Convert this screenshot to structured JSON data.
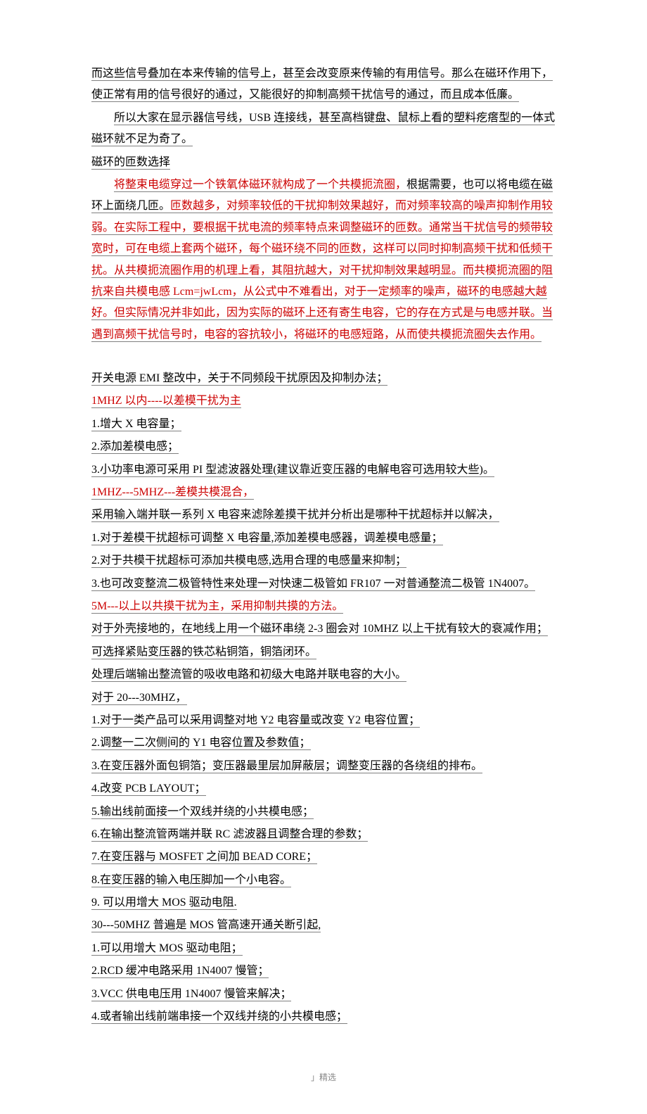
{
  "intro": {
    "p1": "而这些信号叠加在本来传输的信号上，甚至会改变原来传输的有用信号。那么在磁环作用下，使正常有用的信号很好的通过，又能很好的抑制高频干扰信号的通过，而且成本低廉。",
    "p2": "所以大家在显示器信号线，USB 连接线，甚至高档键盘、鼠标上看的塑料疙瘩型的一体式磁环就不足为奇了。",
    "p3": "磁环的匝数选择",
    "p4a": "将整束电缆穿过一个铁氧体磁环就构成了一个共模扼流圈，",
    "p4b": "根据需要，也可以将电缆在磁环上面绕几匝。",
    "p4c": "匝数越多，对频率较低的干扰抑制效果越好，而对频率较高的噪声抑制作用较弱。在实际工程中，要根据干扰电流的频率特点来调整磁环的匝数。通常当干扰信号的频带较宽时，可在电缆上套两个磁环，每个磁环绕不同的匝数，这样可以同时抑制高频干扰和低频干扰。从共模扼流圈作用的机理上看，其阻抗越大，对干扰抑制效果越明显。而共模扼流圈的阻抗来自共模电感 Lcm=jwLcm，从公式中不难看出，对于一定频率的噪声，磁环的电感越大越好。但实际情况并非如此，因为实际的磁环上还有寄生电容，它的存在方式是与电感并联。当遇到高频干扰信号时，电容的容抗较小，将磁环的电感短路，从而使共模扼流圈失去作用。"
  },
  "section": {
    "title": "开关电源 EMI 整改中，关于不同频段干扰原因及抑制办法；",
    "h1": "1MHZ 以内----以差模干扰为主",
    "s1_1": "1.增大 X 电容量；",
    "s1_2": "2.添加差模电感；",
    "s1_3": "3.小功率电源可采用 PI 型滤波器处理(建议靠近变压器的电解电容可选用较大些)。",
    "h2": "1MHZ---5MHZ---差模共模混合，",
    "s2_0": "采用输入端并联一系列 X 电容来滤除差摸干扰并分析出是哪种干扰超标并以解决，",
    "s2_1": "1.对于差模干扰超标可调整 X 电容量,添加差模电感器，调差模电感量；",
    "s2_2": "2.对于共模干扰超标可添加共模电感,选用合理的电感量来抑制；",
    "s2_3": "3.也可改变整流二极管特性来处理一对快速二极管如 FR107 一对普通整流二极管 1N4007。",
    "h3": "5M---以上以共摸干扰为主，采用抑制共摸的方法。",
    "s3_1": "对于外壳接地的，在地线上用一个磁环串绕 2-3 圈会对 10MHZ 以上干扰有较大的衰减作用；",
    "s3_2": "可选择紧贴变压器的铁芯粘铜箔，铜箔闭环。",
    "s3_3": "处理后端输出整流管的吸收电路和初级大电路并联电容的大小。",
    "h4": "对于 20---30MHZ，",
    "s4_1": "1.对于一类产品可以采用调整对地 Y2 电容量或改变 Y2 电容位置；",
    "s4_2": "2.调整一二次侧间的 Y1 电容位置及参数值；",
    "s4_3": "3.在变压器外面包铜箔；变压器最里层加屏蔽层；调整变压器的各绕组的排布。",
    "s4_4": "4.改变 PCB LAYOUT；",
    "s4_5": "5.输出线前面接一个双线并绕的小共模电感；",
    "s4_6": "6.在输出整流管两端并联 RC 滤波器且调整合理的参数；",
    "s4_7": "7.在变压器与 MOSFET 之间加 BEAD CORE；",
    "s4_8": "8.在变压器的输入电压脚加一个小电容。",
    "s4_9": "9. 可以用增大 MOS 驱动电阻.",
    "h5": "30---50MHZ 普遍是 MOS 管高速开通关断引起,",
    "s5_1": "1.可以用增大 MOS 驱动电阻；",
    "s5_2": "2.RCD 缓冲电路采用 1N4007 慢管；",
    "s5_3": "3.VCC 供电电压用 1N4007 慢管来解决；",
    "s5_4": "4.或者输出线前端串接一个双线并绕的小共模电感；"
  },
  "footer": "」精选"
}
